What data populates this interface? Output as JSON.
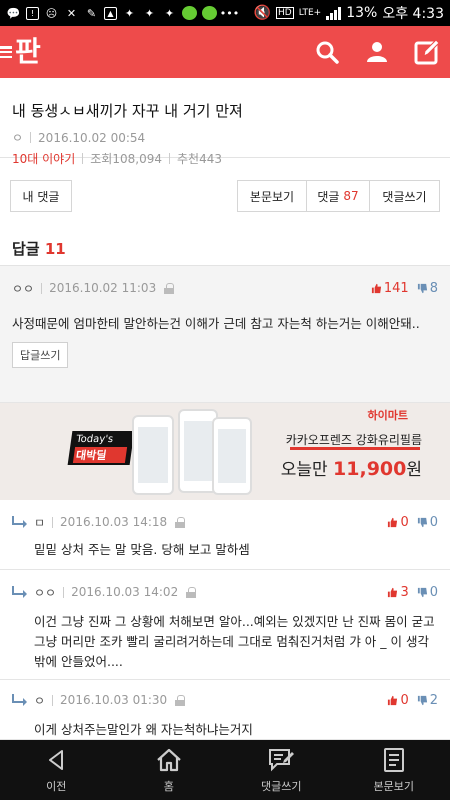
{
  "status_bar": {
    "battery": "13%",
    "time": "오후 4:33",
    "network": "LTE+",
    "hd": "HD"
  },
  "app": {
    "logo": "판",
    "icons": [
      "menu-icon",
      "search-icon",
      "user-icon",
      "edit-icon"
    ],
    "accent": "#ee4b4b"
  },
  "post": {
    "title": "내 동생ㅅㅂ새끼가 자꾸 내 거기 만져",
    "author": "ㅇ",
    "date": "2016.10.02 00:54",
    "category": "10대 이야기",
    "views_label": "조회",
    "views": "108,094",
    "recommend_label": "추천",
    "recommend": "443"
  },
  "tabs": {
    "my_comments": "내 댓글",
    "view_post": "본문보기",
    "comments_label": "댓글",
    "comments_count": "87",
    "write_comment": "댓글쓰기"
  },
  "replies": {
    "label": "답글",
    "count": "11"
  },
  "top_comment": {
    "user": "ㅇㅇ",
    "date": "2016.10.02 11:03",
    "up": "141",
    "down": "8",
    "body": "사정때문에 엄마한테 말안하는건 이해가 근데 참고 자는척 하는거는 이해안돼..",
    "reply_button": "답글쓰기"
  },
  "ad": {
    "badge_top": "Today's",
    "badge_main": "대박딜",
    "brand": "하이마트",
    "product": "카카오프렌즈 강화유리필름",
    "price_prefix": "오늘만",
    "price": "11,900",
    "price_unit": "원"
  },
  "sub_comments": [
    {
      "user": "ㅁ",
      "date": "2016.10.03 14:18",
      "up": "0",
      "down": "0",
      "body": "밑밑 상처 주는 말 맞음. 당해 보고 말하셈"
    },
    {
      "user": "ㅇㅇ",
      "date": "2016.10.03 14:02",
      "up": "3",
      "down": "0",
      "body": "이건 그냥 진짜 그 상황에 처해보면 알아...예외는 있겠지만 난 진짜 몸이 굳고 그냥 머리만 조카 빨리 굴리려거하는데 그대로 멈춰진거처럼 갸 아 _ 이 생각 밖에 안들었어...."
    },
    {
      "user": "ㅇ",
      "date": "2016.10.03 01:30",
      "up": "0",
      "down": "2",
      "body": "이게 상처주는말인가 왜 자는척하냐는거지"
    }
  ],
  "bottom_nav": {
    "back": "이전",
    "home": "홈",
    "write_comment": "댓글쓰기",
    "view_post": "본문보기"
  }
}
